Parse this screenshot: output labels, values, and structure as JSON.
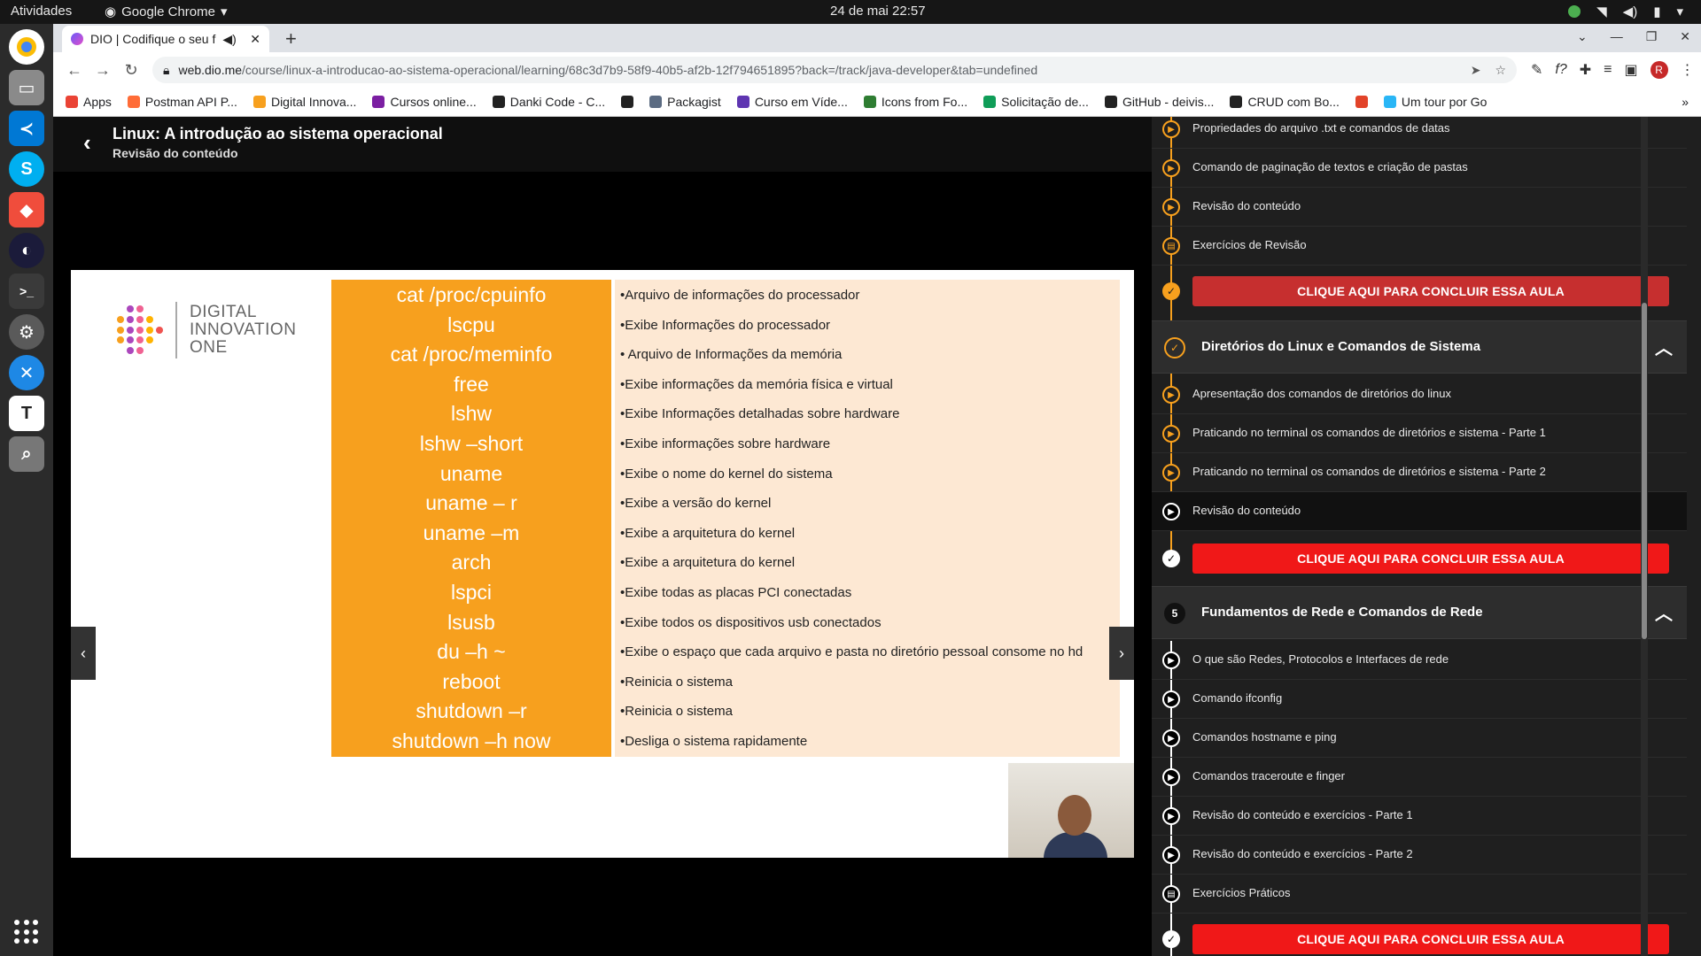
{
  "topbar": {
    "activities": "Atividades",
    "app_name": "Google Chrome",
    "clock": "24 de mai  22:57"
  },
  "browser": {
    "tab_title": "DIO | Codifique o seu f",
    "url_host": "web.dio.me",
    "url_path": "/course/linux-a-introducao-ao-sistema-operacional/learning/68c3d7b9-58f9-40b5-af2b-12f794651895?back=/track/java-developer&tab=undefined",
    "avatar_letter": "R",
    "bookmarks": [
      {
        "label": "Apps",
        "color": "#ea4335"
      },
      {
        "label": "Postman API P...",
        "color": "#ff6c37"
      },
      {
        "label": "Digital Innova...",
        "color": "#f7a01e"
      },
      {
        "label": "Cursos online...",
        "color": "#7b1fa2"
      },
      {
        "label": "Danki Code - C...",
        "color": "#222222"
      },
      {
        "label": "",
        "color": "#222222"
      },
      {
        "label": "Packagist",
        "color": "#5b6b82"
      },
      {
        "label": "Curso em Víde...",
        "color": "#5e35b1"
      },
      {
        "label": "Icons from Fo...",
        "color": "#2e7d32"
      },
      {
        "label": "Solicitação de...",
        "color": "#0f9d58"
      },
      {
        "label": "GitHub - deivis...",
        "color": "#222222"
      },
      {
        "label": "CRUD com Bo...",
        "color": "#222222"
      },
      {
        "label": "",
        "color": "#e24329"
      },
      {
        "label": "Um tour por Go",
        "color": "#29b6f6"
      }
    ]
  },
  "lesson": {
    "title": "Linux: A introdução ao sistema operacional",
    "subtitle": "Revisão do conteúdo"
  },
  "slide": {
    "logo_lines": [
      "DIGITAL",
      "INNOVATION",
      "ONE"
    ],
    "rows": [
      {
        "cmd": "cat /proc/cpuinfo",
        "desc": "•Arquivo de informações do processador"
      },
      {
        "cmd": "lscpu",
        "desc": "•Exibe Informações do processador"
      },
      {
        "cmd": "cat /proc/meminfo",
        "desc": "• Arquivo de Informações da memória"
      },
      {
        "cmd": "free",
        "desc": "•Exibe informações da memória física e virtual"
      },
      {
        "cmd": "lshw",
        "desc": "•Exibe Informações detalhadas sobre hardware"
      },
      {
        "cmd": "lshw –short",
        "desc": "•Exibe informações sobre hardware"
      },
      {
        "cmd": "uname",
        "desc": "•Exibe o nome do kernel do sistema"
      },
      {
        "cmd": "uname – r",
        "desc": "•Exibe a versão do kernel"
      },
      {
        "cmd": "uname –m",
        "desc": "•Exibe a arquitetura do kernel"
      },
      {
        "cmd": "arch",
        "desc": "•Exibe a arquitetura do kernel"
      },
      {
        "cmd": "lspci",
        "desc": "•Exibe todas as placas PCI conectadas"
      },
      {
        "cmd": "lsusb",
        "desc": "•Exibe todos os dispositivos usb conectados"
      },
      {
        "cmd": "du –h ~",
        "desc": "•Exibe o espaço que cada arquivo e pasta no diretório pessoal consome no hd"
      },
      {
        "cmd": "reboot",
        "desc": "•Reinicia o sistema"
      },
      {
        "cmd": "shutdown –r",
        "desc": "•Reinicia o sistema"
      },
      {
        "cmd": "shutdown –h now",
        "desc": "•Desliga o sistema rapidamente"
      }
    ]
  },
  "sidebar": {
    "prev_items": [
      "Propriedades do arquivo .txt e comandos de datas",
      "Comando de paginação de textos e criação de pastas",
      "Revisão do conteúdo",
      "Exercícios de Revisão"
    ],
    "conclude_label": "CLIQUE AQUI PARA CONCLUIR ESSA AULA",
    "section4": {
      "title": "Diretórios do Linux e Comandos de Sistema",
      "items": [
        "Apresentação dos comandos de diretórios do linux",
        "Praticando no terminal os comandos de diretórios e sistema - Parte 1",
        "Praticando no terminal os comandos de diretórios e sistema - Parte 2",
        "Revisão do conteúdo"
      ]
    },
    "section5": {
      "number": "5",
      "title": "Fundamentos de Rede e Comandos de Rede",
      "items": [
        "O que são Redes, Protocolos e Interfaces de rede",
        "Comando ifconfig",
        "Comandos hostname e ping",
        "Comandos traceroute e finger",
        "Revisão do conteúdo e exercícios - Parte 1",
        "Revisão do conteúdo e exercícios - Parte 2",
        "Exercícios Práticos"
      ]
    }
  },
  "colors": {
    "accent_orange": "#f7a01e",
    "conclude_red_dim": "#c62f2f",
    "conclude_red": "#f01818"
  }
}
